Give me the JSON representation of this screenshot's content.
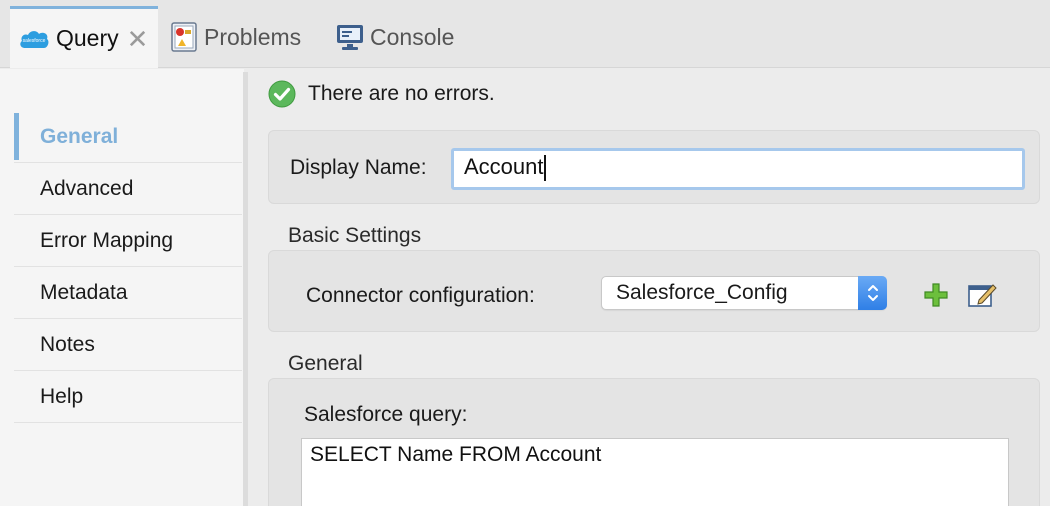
{
  "tabs": [
    {
      "label": "Query",
      "icon": "salesforce-icon",
      "active": true,
      "closable": true
    },
    {
      "label": "Problems",
      "icon": "problems-icon",
      "active": false
    },
    {
      "label": "Console",
      "icon": "console-icon",
      "active": false
    }
  ],
  "salesforce_icon_text": "salesforce",
  "nav": {
    "items": [
      {
        "label": "General",
        "active": true
      },
      {
        "label": "Advanced"
      },
      {
        "label": "Error Mapping"
      },
      {
        "label": "Metadata"
      },
      {
        "label": "Notes"
      },
      {
        "label": "Help"
      }
    ]
  },
  "status": {
    "text": "There are no errors.",
    "icon": "check-circle-icon"
  },
  "display_name": {
    "label": "Display Name:",
    "value": "Account"
  },
  "basic_settings": {
    "title": "Basic Settings",
    "connector_label": "Connector configuration:",
    "connector_value": "Salesforce_Config"
  },
  "general": {
    "title": "General",
    "query_label": "Salesforce query:",
    "query_value": "SELECT Name FROM Account"
  },
  "colors": {
    "accent": "#7fb2dc",
    "active_nav_text": "#7fb0d9",
    "stepper": "#2f7fe6",
    "success": "#5cb85c",
    "add": "#5aa832"
  }
}
